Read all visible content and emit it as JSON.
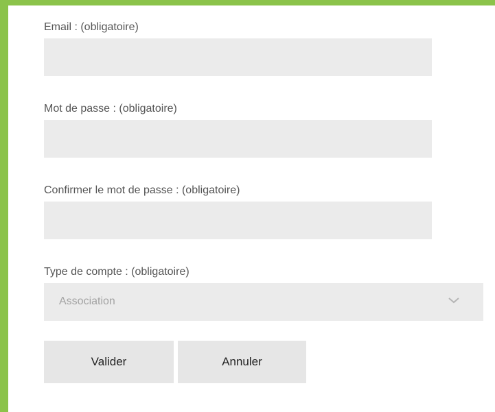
{
  "form": {
    "email": {
      "label": "Email : (obligatoire)",
      "value": "",
      "placeholder": ""
    },
    "password": {
      "label": "Mot de passe : (obligatoire)",
      "value": "",
      "placeholder": ""
    },
    "password_confirm": {
      "label": "Confirmer le mot de passe : (obligatoire)",
      "value": "",
      "placeholder": ""
    },
    "account_type": {
      "label": "Type de compte : (obligatoire)",
      "selected": "Association",
      "icon": "chevron-down-icon"
    }
  },
  "actions": {
    "submit_label": "Valider",
    "cancel_label": "Annuler"
  },
  "colors": {
    "frame_accent": "#8bc34a",
    "field_background": "#ebebeb",
    "button_background": "#e6e6e6",
    "label_text": "#555555",
    "select_text": "#a3a3a3"
  }
}
